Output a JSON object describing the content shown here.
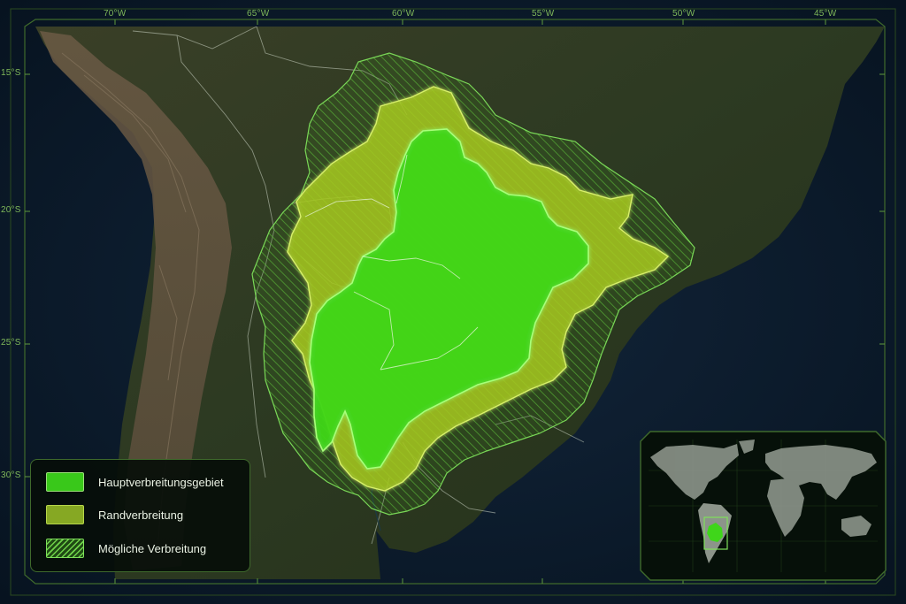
{
  "map": {
    "longitude_ticks": [
      "70°W",
      "65°W",
      "60°W",
      "55°W",
      "50°W",
      "45°W"
    ],
    "latitude_ticks": [
      "15°S",
      "20°S",
      "25°S",
      "30°S"
    ],
    "colors": {
      "core": "#3fd61a",
      "marginal": "#a7c81e",
      "possible": "#4fa82a",
      "ocean": "#0b1a2a",
      "land": "#2d3a22",
      "frame": "#3f6a2c"
    }
  },
  "legend": {
    "items": [
      {
        "label": "Hauptverbreitungsgebiet",
        "color": "#39c81a",
        "pattern": "solid"
      },
      {
        "label": "Randverbreitung",
        "color": "#86a823",
        "pattern": "solid"
      },
      {
        "label": "Mögliche Verbreitung",
        "color": "#2e6a1e",
        "pattern": "hatched"
      }
    ]
  },
  "inset": {
    "icon": "world-locator-map",
    "highlight_color": "#3fd61a"
  }
}
